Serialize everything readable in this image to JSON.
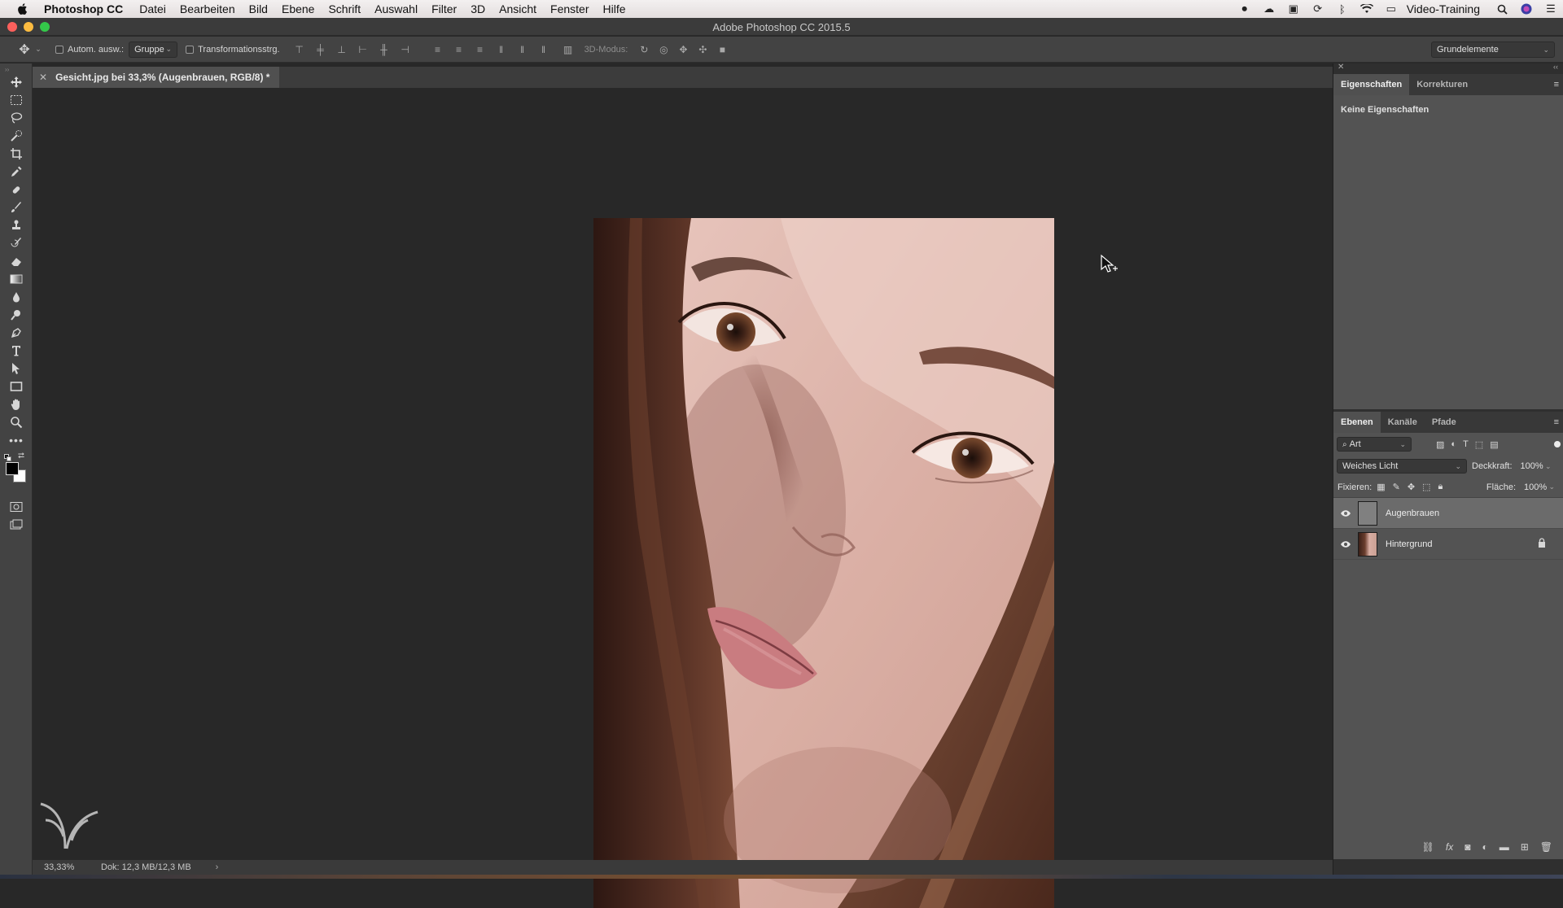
{
  "menubar": {
    "app_name": "Photoshop CC",
    "items": [
      "Datei",
      "Bearbeiten",
      "Bild",
      "Ebene",
      "Schrift",
      "Auswahl",
      "Filter",
      "3D",
      "Ansicht",
      "Fenster",
      "Hilfe"
    ],
    "user": "Video-Training"
  },
  "window": {
    "title": "Adobe Photoshop CC 2015.5",
    "traffic_light_colors": [
      "#fc605c",
      "#fdbc40",
      "#34c84a"
    ]
  },
  "options_bar": {
    "auto_select_label": "Autom. ausw.:",
    "auto_select_value": "Gruppe",
    "transform_label": "Transformationsstrg.",
    "mode_3d_label": "3D-Modus:",
    "workspace": "Grundelemente"
  },
  "document": {
    "tab_title": "Gesicht.jpg bei 33,3% (Augenbrauen, RGB/8) *"
  },
  "toolbar": {
    "tools": [
      "move-tool",
      "marquee-tool",
      "lasso-tool",
      "quick-selection-tool",
      "crop-tool",
      "eyedropper-tool",
      "healing-brush-tool",
      "brush-tool",
      "clone-stamp-tool",
      "history-brush-tool",
      "eraser-tool",
      "gradient-tool",
      "blur-tool",
      "dodge-tool",
      "pen-tool",
      "type-tool",
      "path-selection-tool",
      "rectangle-tool",
      "hand-tool",
      "zoom-tool",
      "more-tools"
    ]
  },
  "status": {
    "zoom": "33,33%",
    "doc_size": "Dok: 12,3 MB/12,3 MB"
  },
  "properties_panel": {
    "tabs": [
      "Eigenschaften",
      "Korrekturen"
    ],
    "empty_text": "Keine Eigenschaften"
  },
  "layers_panel": {
    "tabs": [
      "Ebenen",
      "Kanäle",
      "Pfade"
    ],
    "filter_kind": "Art",
    "blend_mode": "Weiches Licht",
    "opacity_label": "Deckkraft:",
    "opacity_value": "100%",
    "lock_label": "Fixieren:",
    "fill_label": "Fläche:",
    "fill_value": "100%",
    "layers": [
      {
        "name": "Augenbrauen",
        "selected": true,
        "locked": false
      },
      {
        "name": "Hintergrund",
        "selected": false,
        "locked": true
      }
    ]
  }
}
